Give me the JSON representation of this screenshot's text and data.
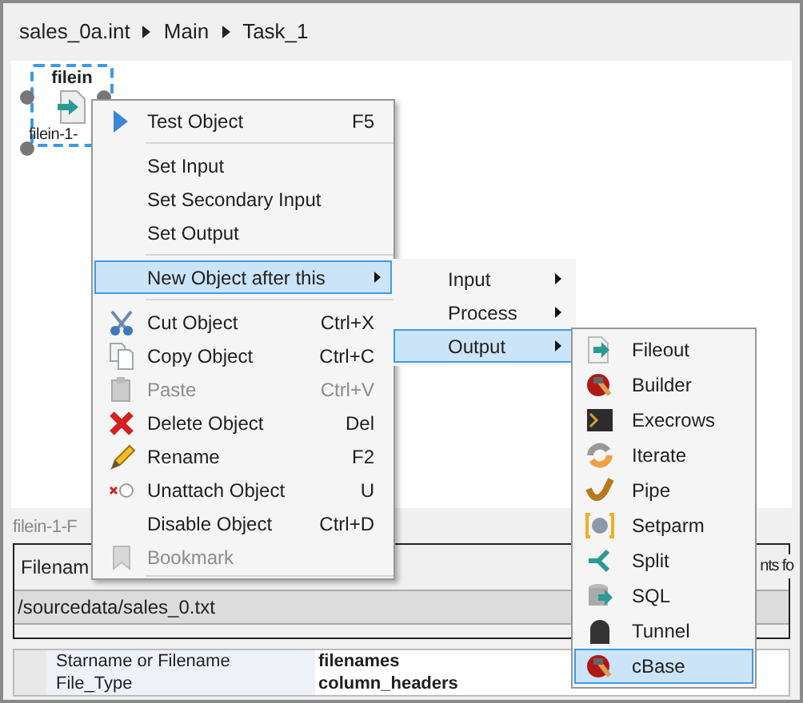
{
  "breadcrumb": [
    "sales_0a.int",
    "Main",
    "Task_1"
  ],
  "node": {
    "title": "filein",
    "label": "filein-1-",
    "selected": true
  },
  "context_menu": [
    {
      "kind": "item",
      "label": "Test Object",
      "shortcut": "F5",
      "disabled": false,
      "selected": false
    },
    {
      "kind": "separator"
    },
    {
      "kind": "item",
      "label": "Set Input",
      "disabled": false,
      "selected": false
    },
    {
      "kind": "item",
      "label": "Set Secondary Input",
      "disabled": false,
      "selected": false
    },
    {
      "kind": "item",
      "label": "Set Output",
      "disabled": false,
      "selected": false
    },
    {
      "kind": "separator"
    },
    {
      "kind": "submenu",
      "label": "New Object after this",
      "disabled": false,
      "selected": true
    },
    {
      "kind": "separator"
    },
    {
      "kind": "item",
      "label": "Cut Object",
      "shortcut": "Ctrl+X",
      "disabled": false,
      "selected": false
    },
    {
      "kind": "item",
      "label": "Copy Object",
      "shortcut": "Ctrl+C",
      "disabled": false,
      "selected": false
    },
    {
      "kind": "item",
      "label": "Paste",
      "shortcut": "Ctrl+V",
      "disabled": true,
      "selected": false
    },
    {
      "kind": "item",
      "label": "Delete Object",
      "shortcut": "Del",
      "disabled": false,
      "selected": false
    },
    {
      "kind": "item",
      "label": "Rename",
      "shortcut": "F2",
      "disabled": false,
      "selected": false
    },
    {
      "kind": "item",
      "label": "Unattach Object",
      "shortcut": "U",
      "disabled": false,
      "selected": false
    },
    {
      "kind": "item",
      "label": "Disable Object",
      "shortcut": "Ctrl+D",
      "disabled": false,
      "selected": false
    },
    {
      "kind": "item",
      "label": "Bookmark",
      "disabled": true,
      "selected": false
    },
    {
      "kind": "separator"
    }
  ],
  "new_object_menu": [
    {
      "label": "Input",
      "selected": false
    },
    {
      "label": "Process",
      "selected": false
    },
    {
      "label": "Output",
      "selected": true
    }
  ],
  "output_menu": [
    {
      "label": "Fileout",
      "selected": false
    },
    {
      "label": "Builder",
      "selected": false
    },
    {
      "label": "Execrows",
      "selected": false
    },
    {
      "label": "Iterate",
      "selected": false
    },
    {
      "label": "Pipe",
      "selected": false
    },
    {
      "label": "Setparm",
      "selected": false
    },
    {
      "label": "Split",
      "selected": false
    },
    {
      "label": "SQL",
      "selected": false
    },
    {
      "label": "Tunnel",
      "selected": false
    },
    {
      "label": "cBase",
      "selected": true
    }
  ],
  "panel": {
    "title": "filein-1-F",
    "column_1": "Filenam",
    "column_2": "nts fo",
    "row": "/sourcedata/sales_0.txt",
    "properties": [
      {
        "name": "Starname or Filename",
        "value": "filenames"
      },
      {
        "name": "File_Type",
        "value": "column_headers"
      }
    ]
  }
}
